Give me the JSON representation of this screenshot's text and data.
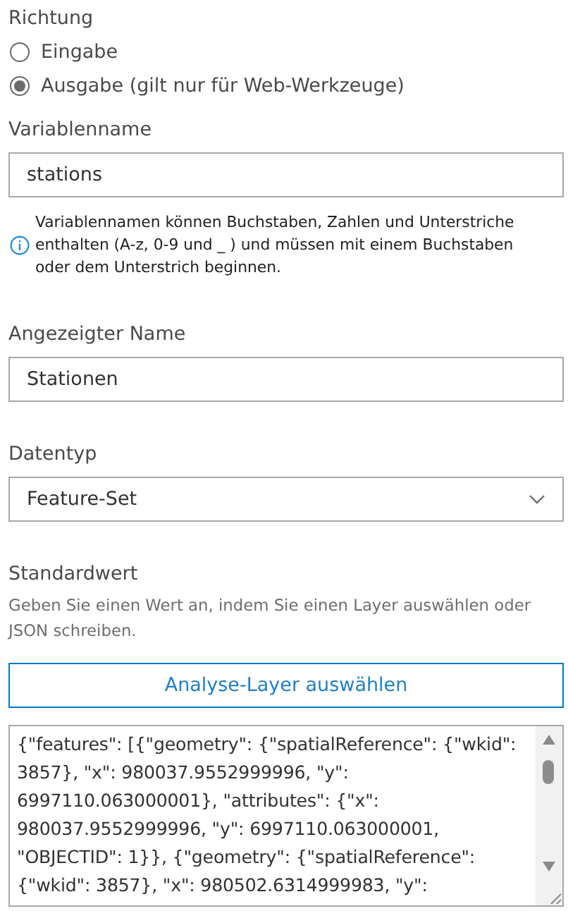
{
  "direction": {
    "label": "Richtung",
    "options": [
      {
        "label": "Eingabe",
        "selected": false
      },
      {
        "label": "Ausgabe (gilt nur für Web-Werkzeuge)",
        "selected": true
      }
    ]
  },
  "variable_name": {
    "label": "Variablenname",
    "value": "stations",
    "info": "Variablennamen können Buchstaben, Zahlen und Unterstriche enthalten (A-z, 0-9 und _ ) und müssen mit einem Buchstaben oder dem Unterstrich beginnen."
  },
  "display_name": {
    "label": "Angezeigter Name",
    "value": "Stationen"
  },
  "data_type": {
    "label": "Datentyp",
    "value": "Feature-Set"
  },
  "default_value": {
    "label": "Standardwert",
    "hint": "Geben Sie einen Wert an, indem Sie einen Layer auswählen oder JSON schreiben.",
    "button": "Analyse-Layer auswählen",
    "json_lines": [
      "{\"features\": [{\"geometry\": {\"spatialReference\": {\"wkid\":",
      "3857}, \"x\": 980037.9552999996, \"y\":",
      "6997110.063000001}, \"attributes\": {\"x\":",
      "980037.9552999996, \"y\": 6997110.063000001,",
      "\"OBJECTID\": 1}}, {\"geometry\": {\"spatialReference\":",
      "{\"wkid\": 3857}, \"x\": 980502.6314999983, \"y\":"
    ]
  }
}
